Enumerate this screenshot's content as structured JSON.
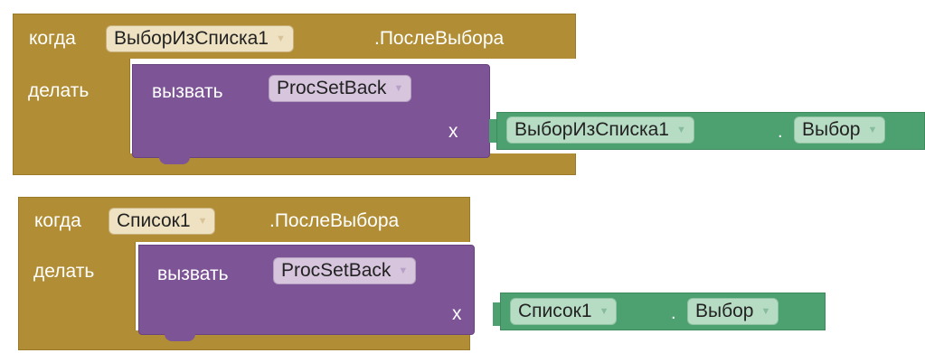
{
  "blocks": [
    {
      "when_label": "когда",
      "component": "ВыборИзСписка1",
      "event": ".ПослеВыбора",
      "do_label": "делать",
      "call_label": "вызвать",
      "procedure": "ProcSetBack",
      "arg_label": "x",
      "getter_component": "ВыборИзСписка1",
      "getter_dot": ".",
      "getter_property": "Выбор"
    },
    {
      "when_label": "когда",
      "component": "Список1",
      "event": ".ПослеВыбора",
      "do_label": "делать",
      "call_label": "вызвать",
      "procedure": "ProcSetBack",
      "arg_label": "x",
      "getter_component": "Список1",
      "getter_dot": ".",
      "getter_property": "Выбор"
    }
  ],
  "colors": {
    "event_block": "#b18e35",
    "procedure_call": "#7d5496",
    "component_getter": "#4da06f"
  },
  "icons": {
    "dropdown": "dropdown-triangle-icon"
  }
}
